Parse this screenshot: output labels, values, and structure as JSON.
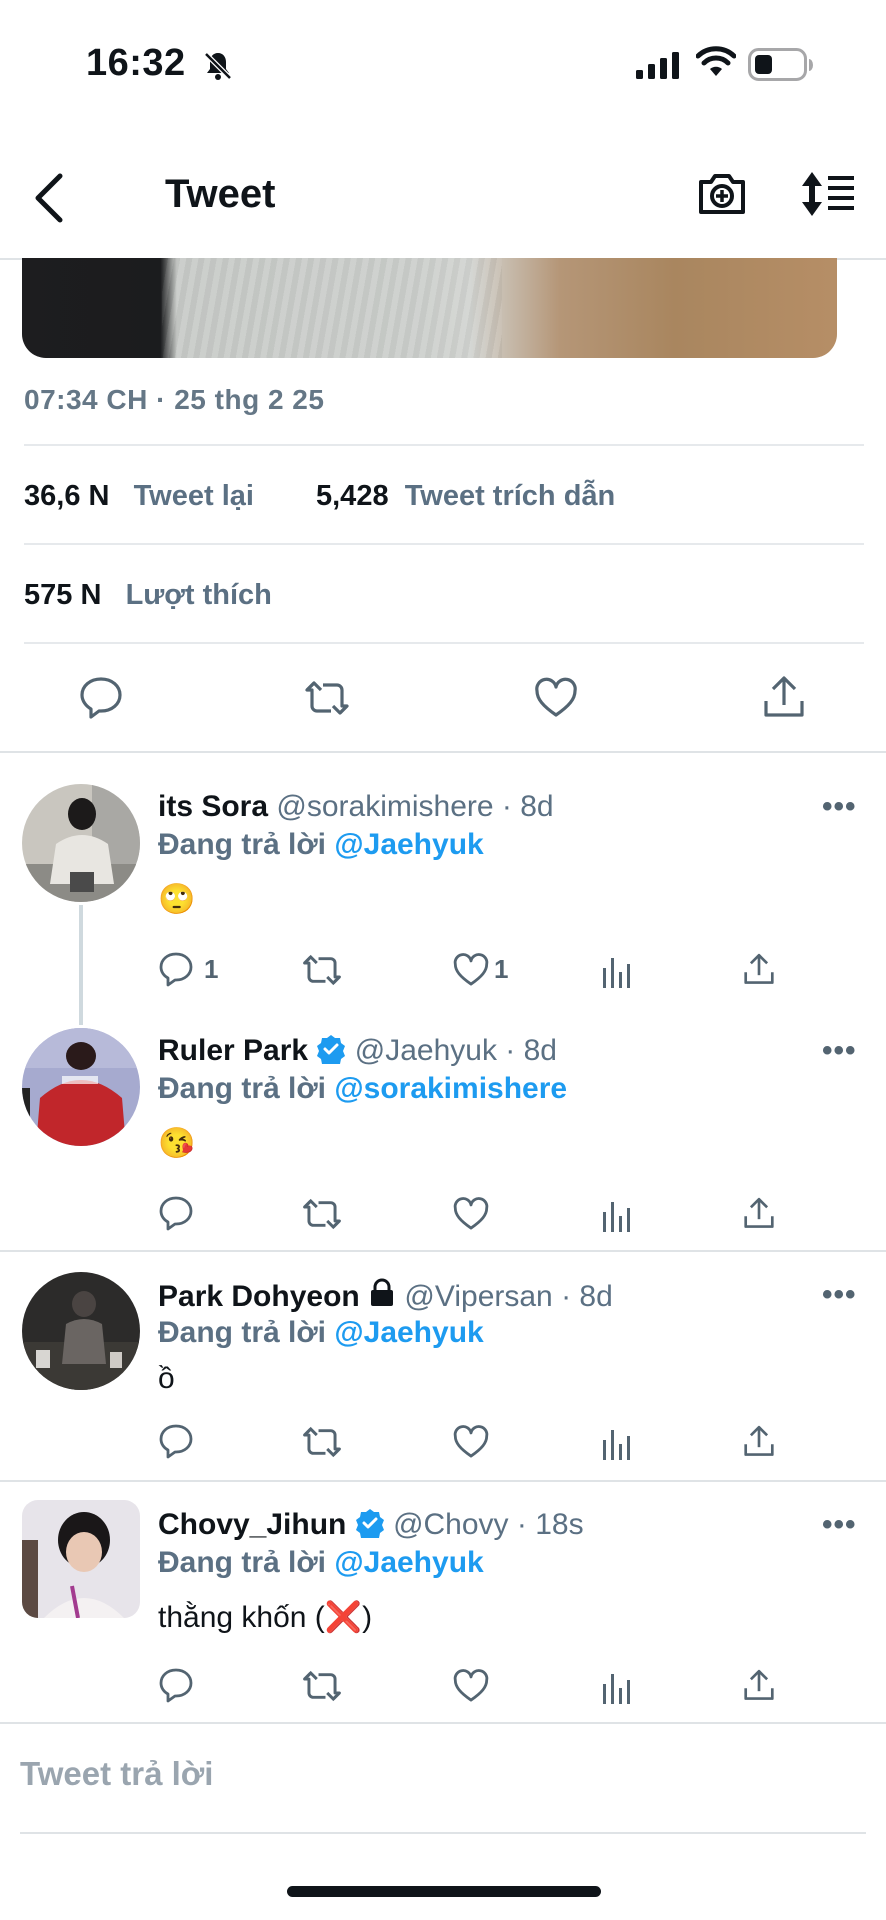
{
  "status_bar": {
    "time": "16:32"
  },
  "nav": {
    "title": "Tweet"
  },
  "tweet": {
    "timestamp": "07:34 CH · 25 thg 2 25",
    "retweets_count": "36,6 N",
    "retweets_label": "Tweet lại",
    "quotes_count": "5,428",
    "quotes_label": "Tweet trích dẫn",
    "likes_count": "575 N",
    "likes_label": "Lượt thích"
  },
  "replies": [
    {
      "name": "its Sora",
      "handle": "@sorakimishere · 8d",
      "replying_prefix": "Đang trả lời",
      "replying_to": "@Jaehyuk",
      "text": "🙄",
      "reply_count": "1",
      "like_count": "1"
    },
    {
      "name": "Ruler Park",
      "handle": "@Jaehyuk · 8d",
      "replying_prefix": "Đang trả lời",
      "replying_to": "@sorakimishere",
      "text": "😘"
    },
    {
      "name": "Park Dohyeon",
      "handle": "@Vipersan · 8d",
      "replying_prefix": "Đang trả lời",
      "replying_to": "@Jaehyuk",
      "text": "ồ"
    },
    {
      "name": "Chovy_Jihun",
      "handle": "@Chovy · 18s",
      "replying_prefix": "Đang trả lời",
      "replying_to": "@Jaehyuk",
      "text_before": "thằng khốn (",
      "text_emoji": "❌",
      "text_after": ")"
    }
  ],
  "more_label": "•••",
  "composer": {
    "placeholder": "Tweet trả lời"
  },
  "colors": {
    "accent": "#1d9bf0",
    "muted": "#5b7083",
    "text": "#0f1419"
  }
}
